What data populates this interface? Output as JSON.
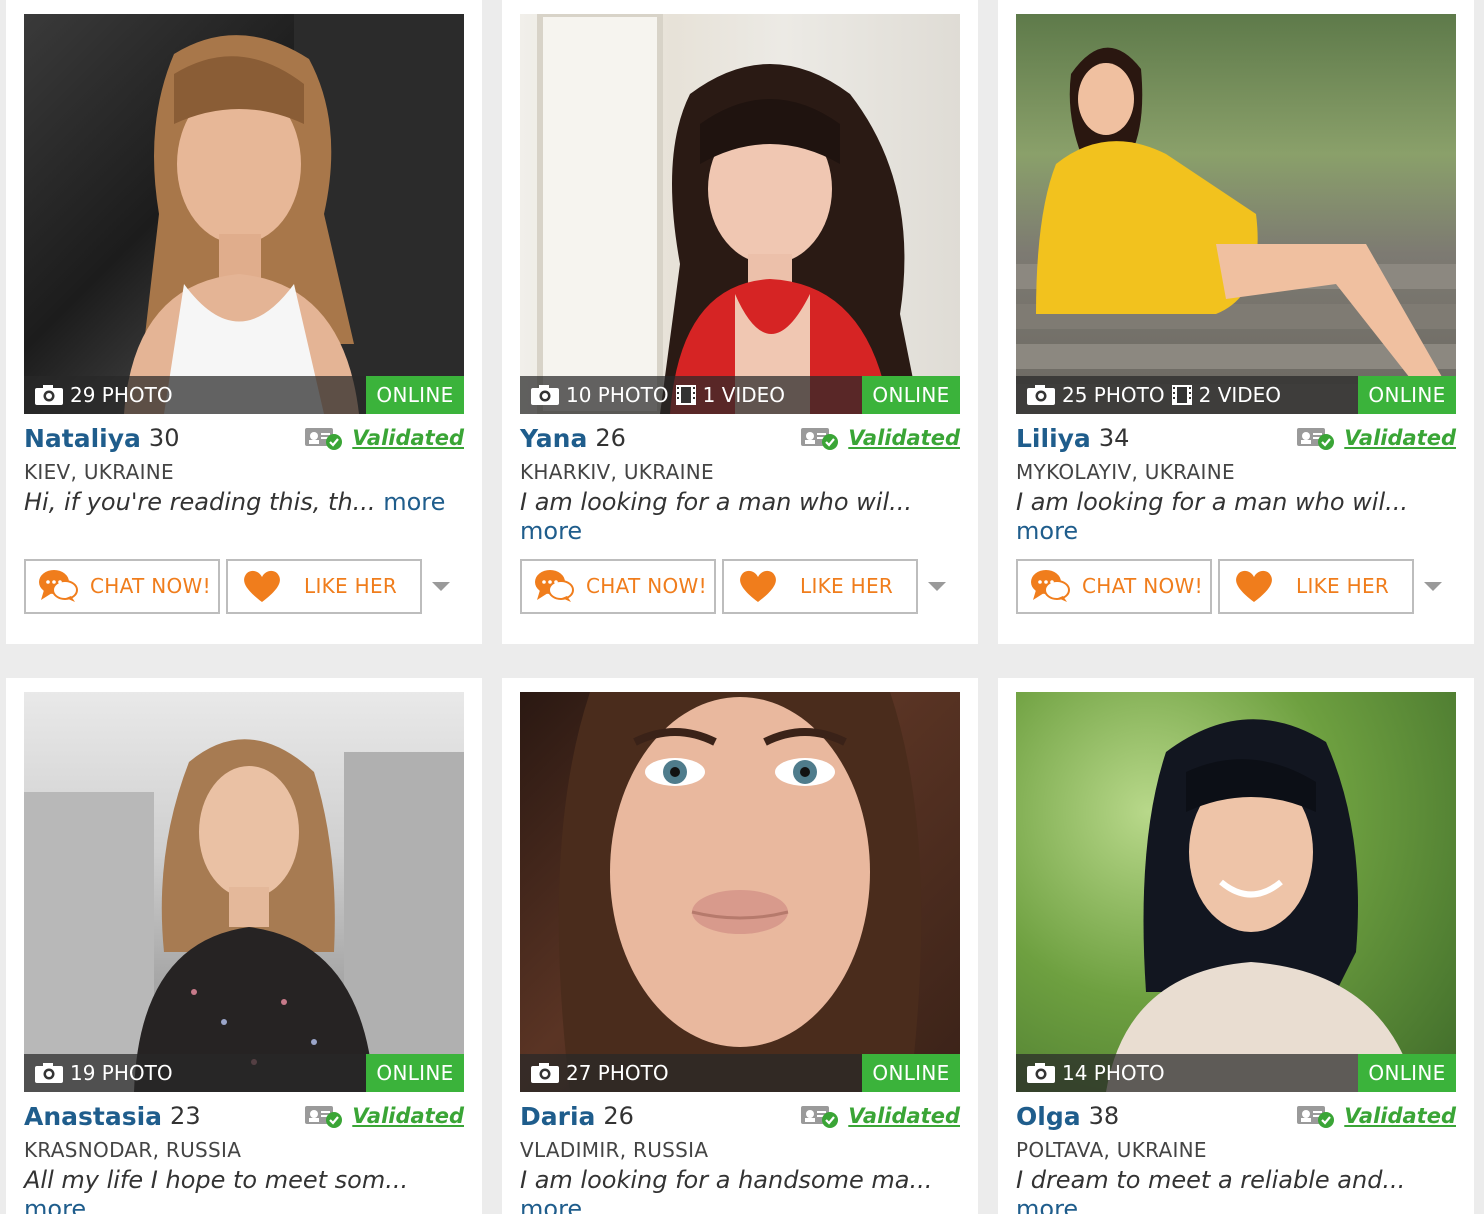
{
  "colors": {
    "name_link": "#1f5d8c",
    "online_badge": "#3bb33b",
    "validated": "#3aa536",
    "button_text": "#f07d1c"
  },
  "cards": [
    {
      "name": "Nataliya",
      "age": "30",
      "location": "KIEV, UKRAINE",
      "photos": "29 PHOTO",
      "videos": "",
      "status": "ONLINE",
      "validated": "Validated",
      "description": "Hi, if you're reading this, th...",
      "more": "more",
      "chat": "CHAT NOW!",
      "like": "LIKE HER"
    },
    {
      "name": "Yana",
      "age": "26",
      "location": "KHARKIV, UKRAINE",
      "photos": "10 PHOTO",
      "videos": "1 VIDEO",
      "status": "ONLINE",
      "validated": "Validated",
      "description": "I am looking for a man who wil...",
      "more": "more",
      "chat": "CHAT NOW!",
      "like": "LIKE HER"
    },
    {
      "name": "Liliya",
      "age": "34",
      "location": "MYKOLAYIV, UKRAINE",
      "photos": "25 PHOTO",
      "videos": "2 VIDEO",
      "status": "ONLINE",
      "validated": "Validated",
      "description": "I am looking for a man who wil...",
      "more": "more",
      "chat": "CHAT NOW!",
      "like": "LIKE HER"
    },
    {
      "name": "Anastasia",
      "age": "23",
      "location": "KRASNODAR, RUSSIA",
      "photos": "19 PHOTO",
      "videos": "",
      "status": "ONLINE",
      "validated": "Validated",
      "description": "All my life I hope to meet som...",
      "more": "more",
      "chat": "",
      "like": ""
    },
    {
      "name": "Daria",
      "age": "26",
      "location": "VLADIMIR, RUSSIA",
      "photos": "27 PHOTO",
      "videos": "",
      "status": "ONLINE",
      "validated": "Validated",
      "description": "I am looking for a handsome ma...",
      "more": "more",
      "chat": "",
      "like": ""
    },
    {
      "name": "Olga",
      "age": "38",
      "location": "POLTAVA, UKRAINE",
      "photos": "14 PHOTO",
      "videos": "",
      "status": "ONLINE",
      "validated": "Validated",
      "description": "I dream to meet a reliable and...",
      "more": "more",
      "chat": "",
      "like": ""
    }
  ]
}
